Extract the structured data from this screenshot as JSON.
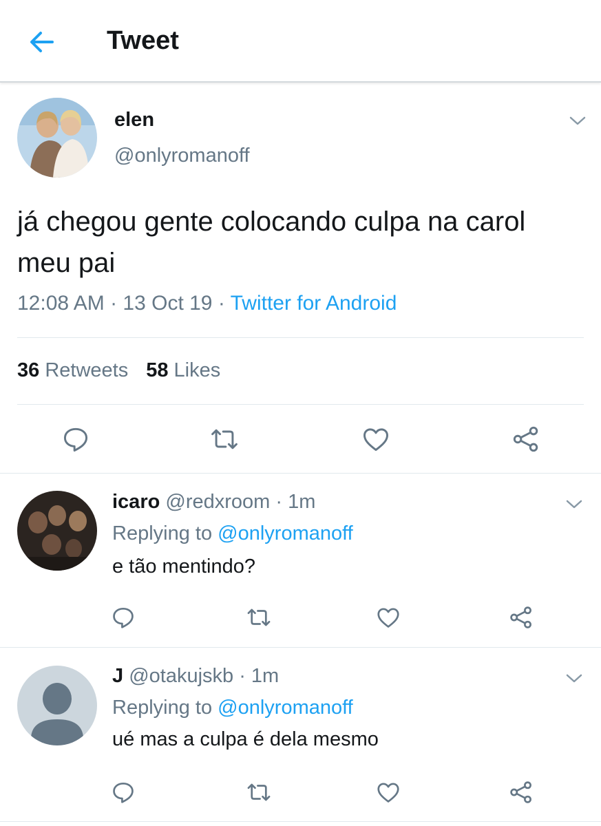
{
  "header": {
    "title": "Tweet"
  },
  "tweet": {
    "author_name": "elen",
    "author_handle": "@onlyromanoff",
    "text": "já chegou gente colocando culpa na carol meu pai",
    "time": "12:08 AM · 13 Oct 19 · ",
    "source": "Twitter for Android",
    "retweets_count": "36",
    "retweets_label": "Retweets",
    "likes_count": "58",
    "likes_label": "Likes"
  },
  "replies": [
    {
      "name": "icaro",
      "handle_time": "@redxroom · 1m",
      "replying_prefix": "Replying to ",
      "replying_to": "@onlyromanoff",
      "text": "e tão mentindo?"
    },
    {
      "name": "J",
      "handle_time": "@otakujskb · 1m",
      "replying_prefix": "Replying to ",
      "replying_to": "@onlyromanoff",
      "text": "ué mas a culpa é dela mesmo"
    }
  ],
  "icons": {
    "back": "arrow-left-icon",
    "menu": "chevron-down-icon",
    "reply": "reply-icon",
    "retweet": "retweet-icon",
    "like": "heart-icon",
    "share": "share-icon"
  },
  "colors": {
    "accent": "#1da1f2",
    "secondary_text": "#657786",
    "primary_text": "#14171a",
    "divider": "#e1e8ed"
  }
}
